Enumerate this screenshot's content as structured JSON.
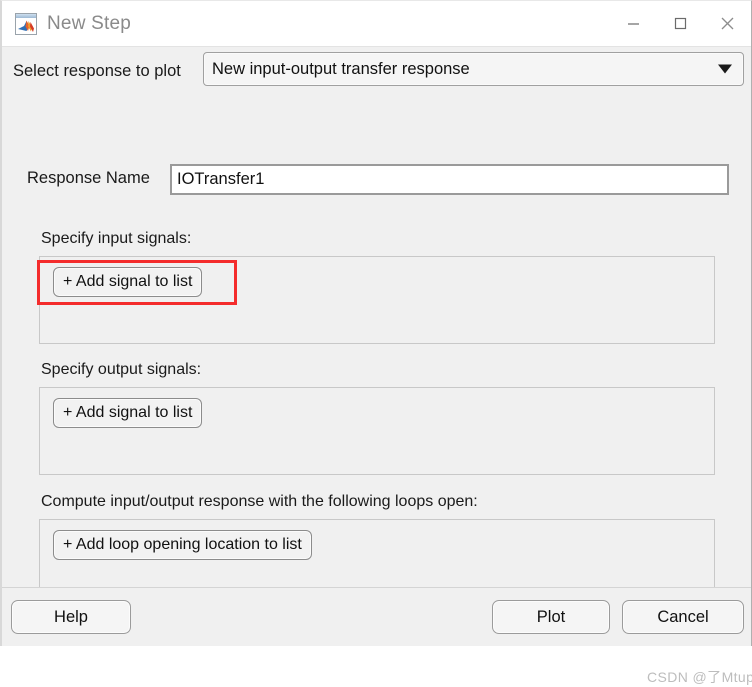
{
  "window": {
    "title": "New Step",
    "icon": "matlab-logo-icon",
    "controls": {
      "minimize": "minimize-icon",
      "maximize": "maximize-icon",
      "close": "close-icon"
    }
  },
  "form": {
    "select_response_label": "Select response to plot",
    "response_type": {
      "value": "New input-output transfer response",
      "arrow_icon": "chevron-down-icon"
    },
    "response_name_label": "Response Name",
    "response_name_value": "IOTransfer1",
    "response_name_placeholder": "Response Name"
  },
  "sections": [
    {
      "label": "Specify input signals:",
      "button": "+ Add signal to list",
      "items": []
    },
    {
      "label": "Specify output signals:",
      "button": "+ Add signal to list",
      "items": []
    },
    {
      "label": "Compute input/output response with the following loops open:",
      "button": "+ Add loop opening location to list",
      "items": []
    }
  ],
  "footer": {
    "help_label": "Help",
    "plot_label": "Plot",
    "cancel_label": "Cancel"
  },
  "annotation": {
    "highlight_color": "#f42c2c",
    "target": "+ Add signal to list"
  },
  "watermark": "CSDN @了Mtup"
}
